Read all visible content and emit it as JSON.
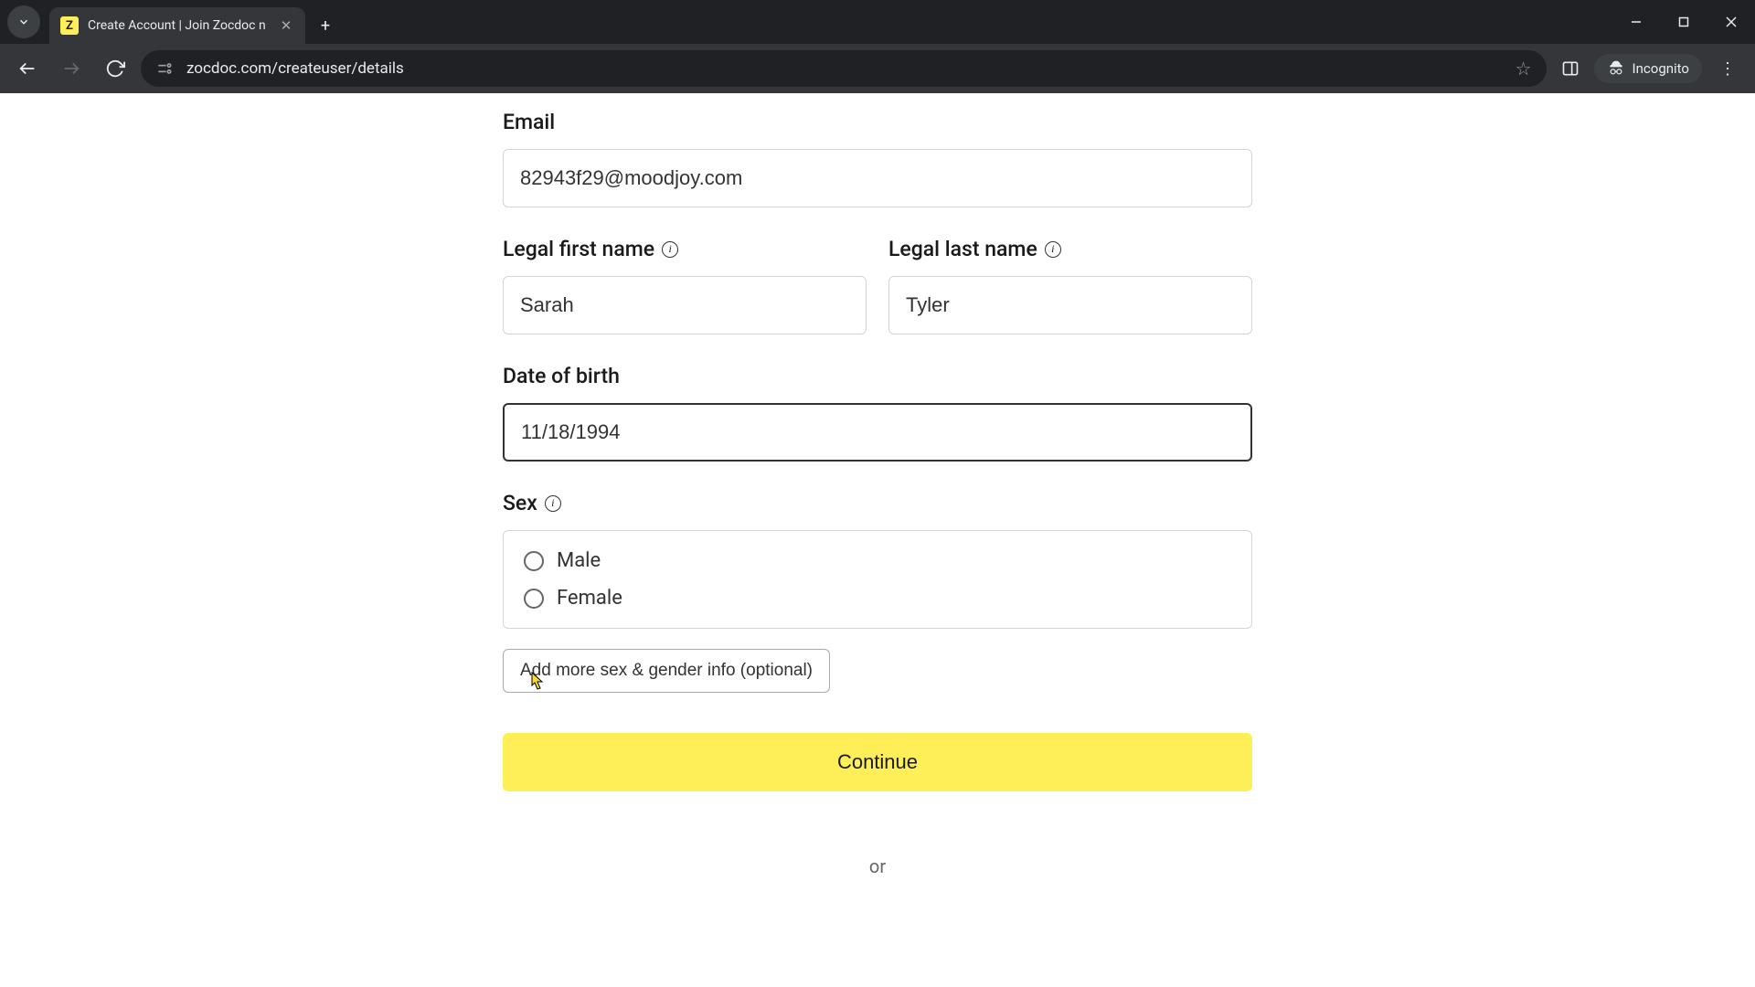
{
  "browser": {
    "tab_title": "Create Account | Join Zocdoc n",
    "url": "zocdoc.com/createuser/details",
    "incognito_label": "Incognito"
  },
  "form": {
    "email_label": "Email",
    "email_value": "82943f29@moodjoy.com",
    "first_name_label": "Legal first name",
    "first_name_value": "Sarah",
    "last_name_label": "Legal last name",
    "last_name_value": "Tyler",
    "dob_label": "Date of birth",
    "dob_value": "11/18/1994",
    "sex_label": "Sex",
    "sex_options": {
      "male": "Male",
      "female": "Female"
    },
    "add_more_label": "Add more sex & gender info (optional)",
    "continue_label": "Continue",
    "divider_or": "or"
  }
}
